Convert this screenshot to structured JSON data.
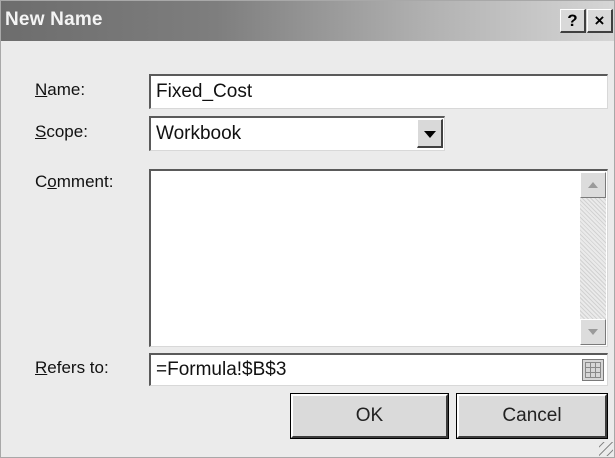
{
  "dialog": {
    "title": "New Name",
    "help_button": "?",
    "close_button": "×"
  },
  "name": {
    "label_accel": "N",
    "label_rest": "ame:",
    "value": "Fixed_Cost"
  },
  "scope": {
    "label_accel": "S",
    "label_rest": "cope:",
    "value": "Workbook"
  },
  "comment": {
    "label_pre": "C",
    "label_accel": "o",
    "label_rest": "mment:",
    "value": ""
  },
  "refers_to": {
    "label_accel": "R",
    "label_rest": "efers to:",
    "value": "=Formula!$B$3"
  },
  "buttons": {
    "ok": "OK",
    "cancel": "Cancel"
  }
}
